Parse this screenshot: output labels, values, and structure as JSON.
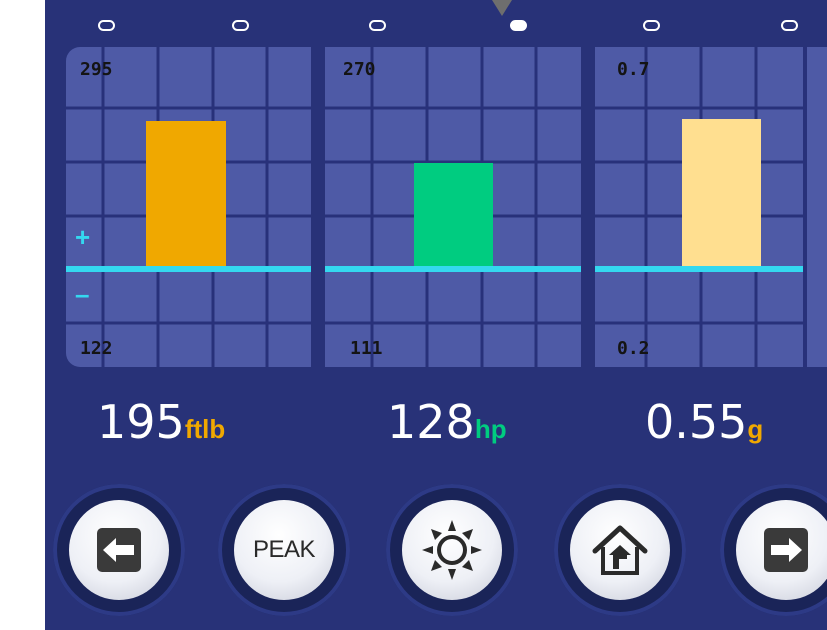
{
  "page_dots": [
    false,
    false,
    false,
    true,
    false,
    false
  ],
  "gauges": [
    {
      "max_label": "295",
      "min_label": "122",
      "value": 195,
      "unit": "ftlb",
      "unit_color": "#f0a800",
      "bar_color": "#f0a800"
    },
    {
      "max_label": "270",
      "min_label": "111",
      "value": 128,
      "unit": "hp",
      "unit_color": "#00cc80",
      "bar_color": "#00cc80"
    },
    {
      "max_label": "0.7",
      "min_label": "0.2",
      "value": 0.55,
      "unit": "g",
      "unit_color": "#f0a800",
      "bar_color": "#ffdf90"
    }
  ],
  "readouts": [
    {
      "number": "195",
      "unit": "ftlb"
    },
    {
      "number": "128",
      "unit": "hp"
    },
    {
      "number": "0.55",
      "unit": "g"
    }
  ],
  "signs": {
    "plus": "+",
    "minus": "–"
  },
  "buttons": {
    "back_icon": "arrow-left-icon",
    "peak_label": "PEAK",
    "brightness_icon": "sun-icon",
    "home_icon": "home-icon",
    "forward_icon": "arrow-right-icon"
  },
  "colors": {
    "background": "#283278",
    "panel": "#4e5aa6",
    "grid": "#28317a",
    "zero_line": "#34d8f0"
  }
}
